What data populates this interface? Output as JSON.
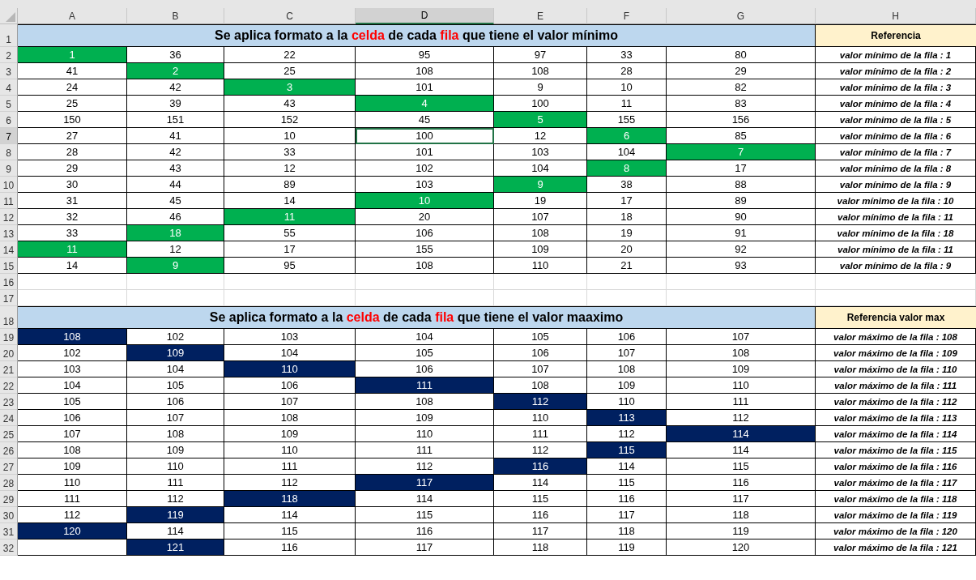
{
  "columns": [
    {
      "label": "A",
      "selected": false
    },
    {
      "label": "B",
      "selected": false
    },
    {
      "label": "C",
      "selected": false
    },
    {
      "label": "D",
      "selected": true
    },
    {
      "label": "E",
      "selected": false
    },
    {
      "label": "F",
      "selected": false
    },
    {
      "label": "G",
      "selected": false
    },
    {
      "label": "H",
      "selected": false
    }
  ],
  "rows": [
    {
      "number": "1",
      "selected": false,
      "kind": "title",
      "title": [
        {
          "text": "Se aplica formato a la ",
          "highlighted": false
        },
        {
          "text": "celda",
          "highlighted": true
        },
        {
          "text": " de cada ",
          "highlighted": false
        },
        {
          "text": "fila",
          "highlighted": true
        },
        {
          "text": " que tiene el valor mínimo",
          "highlighted": false
        }
      ],
      "reference": "Referencia"
    },
    {
      "number": "2",
      "selected": false,
      "kind": "data",
      "cells": [
        {
          "value": "1",
          "kind": "min"
        },
        {
          "value": "36",
          "kind": "plain"
        },
        {
          "value": "22",
          "kind": "plain"
        },
        {
          "value": "95",
          "kind": "plain"
        },
        {
          "value": "97",
          "kind": "plain"
        },
        {
          "value": "33",
          "kind": "plain"
        },
        {
          "value": "80",
          "kind": "plain"
        }
      ],
      "reference": "valor mínimo de la fila : 1"
    },
    {
      "number": "3",
      "selected": false,
      "kind": "data",
      "cells": [
        {
          "value": "41",
          "kind": "plain"
        },
        {
          "value": "2",
          "kind": "min"
        },
        {
          "value": "25",
          "kind": "plain"
        },
        {
          "value": "108",
          "kind": "plain"
        },
        {
          "value": "108",
          "kind": "plain"
        },
        {
          "value": "28",
          "kind": "plain"
        },
        {
          "value": "29",
          "kind": "plain"
        }
      ],
      "reference": "valor mínimo de la fila : 2"
    },
    {
      "number": "4",
      "selected": false,
      "kind": "data",
      "cells": [
        {
          "value": "24",
          "kind": "plain"
        },
        {
          "value": "42",
          "kind": "plain"
        },
        {
          "value": "3",
          "kind": "min"
        },
        {
          "value": "101",
          "kind": "plain"
        },
        {
          "value": "9",
          "kind": "plain"
        },
        {
          "value": "10",
          "kind": "plain"
        },
        {
          "value": "82",
          "kind": "plain"
        }
      ],
      "reference": "valor mínimo de la fila : 3"
    },
    {
      "number": "5",
      "selected": false,
      "kind": "data",
      "cells": [
        {
          "value": "25",
          "kind": "plain"
        },
        {
          "value": "39",
          "kind": "plain"
        },
        {
          "value": "43",
          "kind": "plain"
        },
        {
          "value": "4",
          "kind": "min"
        },
        {
          "value": "100",
          "kind": "plain"
        },
        {
          "value": "11",
          "kind": "plain"
        },
        {
          "value": "83",
          "kind": "plain"
        }
      ],
      "reference": "valor mínimo de la fila : 4"
    },
    {
      "number": "6",
      "selected": false,
      "kind": "data",
      "cells": [
        {
          "value": "150",
          "kind": "plain"
        },
        {
          "value": "151",
          "kind": "plain"
        },
        {
          "value": "152",
          "kind": "plain"
        },
        {
          "value": "45",
          "kind": "plain"
        },
        {
          "value": "5",
          "kind": "min"
        },
        {
          "value": "155",
          "kind": "plain"
        },
        {
          "value": "156",
          "kind": "plain"
        }
      ],
      "reference": "valor mínimo de la fila : 5"
    },
    {
      "number": "7",
      "selected": true,
      "kind": "data",
      "cells": [
        {
          "value": "27",
          "kind": "plain"
        },
        {
          "value": "41",
          "kind": "plain"
        },
        {
          "value": "10",
          "kind": "plain"
        },
        {
          "value": "100",
          "kind": "plain"
        },
        {
          "value": "12",
          "kind": "plain"
        },
        {
          "value": "6",
          "kind": "min"
        },
        {
          "value": "85",
          "kind": "plain"
        }
      ],
      "reference": "valor mínimo de la fila : 6"
    },
    {
      "number": "8",
      "selected": false,
      "kind": "data",
      "cells": [
        {
          "value": "28",
          "kind": "plain"
        },
        {
          "value": "42",
          "kind": "plain"
        },
        {
          "value": "33",
          "kind": "plain"
        },
        {
          "value": "101",
          "kind": "plain"
        },
        {
          "value": "103",
          "kind": "plain"
        },
        {
          "value": "104",
          "kind": "plain"
        },
        {
          "value": "7",
          "kind": "min"
        }
      ],
      "reference": "valor mínimo de la fila : 7"
    },
    {
      "number": "9",
      "selected": false,
      "kind": "data",
      "cells": [
        {
          "value": "29",
          "kind": "plain"
        },
        {
          "value": "43",
          "kind": "plain"
        },
        {
          "value": "12",
          "kind": "plain"
        },
        {
          "value": "102",
          "kind": "plain"
        },
        {
          "value": "104",
          "kind": "plain"
        },
        {
          "value": "8",
          "kind": "min"
        },
        {
          "value": "17",
          "kind": "plain"
        }
      ],
      "reference": "valor mínimo de la fila : 8"
    },
    {
      "number": "10",
      "selected": false,
      "kind": "data",
      "cells": [
        {
          "value": "30",
          "kind": "plain"
        },
        {
          "value": "44",
          "kind": "plain"
        },
        {
          "value": "89",
          "kind": "plain"
        },
        {
          "value": "103",
          "kind": "plain"
        },
        {
          "value": "9",
          "kind": "min"
        },
        {
          "value": "38",
          "kind": "plain"
        },
        {
          "value": "88",
          "kind": "plain"
        }
      ],
      "reference": "valor mínimo de la fila : 9"
    },
    {
      "number": "11",
      "selected": false,
      "kind": "data",
      "cells": [
        {
          "value": "31",
          "kind": "plain"
        },
        {
          "value": "45",
          "kind": "plain"
        },
        {
          "value": "14",
          "kind": "plain"
        },
        {
          "value": "10",
          "kind": "min"
        },
        {
          "value": "19",
          "kind": "plain"
        },
        {
          "value": "17",
          "kind": "plain"
        },
        {
          "value": "89",
          "kind": "plain"
        }
      ],
      "reference": "valor mínimo de la fila : 10"
    },
    {
      "number": "12",
      "selected": false,
      "kind": "data",
      "cells": [
        {
          "value": "32",
          "kind": "plain"
        },
        {
          "value": "46",
          "kind": "plain"
        },
        {
          "value": "11",
          "kind": "min"
        },
        {
          "value": "20",
          "kind": "plain"
        },
        {
          "value": "107",
          "kind": "plain"
        },
        {
          "value": "18",
          "kind": "plain"
        },
        {
          "value": "90",
          "kind": "plain"
        }
      ],
      "reference": "valor mínimo de la fila : 11"
    },
    {
      "number": "13",
      "selected": false,
      "kind": "data",
      "cells": [
        {
          "value": "33",
          "kind": "plain"
        },
        {
          "value": "18",
          "kind": "min"
        },
        {
          "value": "55",
          "kind": "plain"
        },
        {
          "value": "106",
          "kind": "plain"
        },
        {
          "value": "108",
          "kind": "plain"
        },
        {
          "value": "19",
          "kind": "plain"
        },
        {
          "value": "91",
          "kind": "plain"
        }
      ],
      "reference": "valor mínimo de la fila : 18"
    },
    {
      "number": "14",
      "selected": false,
      "kind": "data",
      "cells": [
        {
          "value": "11",
          "kind": "min"
        },
        {
          "value": "12",
          "kind": "plain"
        },
        {
          "value": "17",
          "kind": "plain"
        },
        {
          "value": "155",
          "kind": "plain"
        },
        {
          "value": "109",
          "kind": "plain"
        },
        {
          "value": "20",
          "kind": "plain"
        },
        {
          "value": "92",
          "kind": "plain"
        }
      ],
      "reference": "valor mínimo de la fila : 11"
    },
    {
      "number": "15",
      "selected": false,
      "kind": "data",
      "cells": [
        {
          "value": "14",
          "kind": "plain"
        },
        {
          "value": "9",
          "kind": "min"
        },
        {
          "value": "95",
          "kind": "plain"
        },
        {
          "value": "108",
          "kind": "plain"
        },
        {
          "value": "110",
          "kind": "plain"
        },
        {
          "value": "21",
          "kind": "plain"
        },
        {
          "value": "93",
          "kind": "plain"
        }
      ],
      "reference": "valor mínimo de la fila : 9"
    },
    {
      "number": "16",
      "selected": false,
      "kind": "blank"
    },
    {
      "number": "17",
      "selected": false,
      "kind": "blank"
    },
    {
      "number": "18",
      "selected": false,
      "kind": "title",
      "title": [
        {
          "text": "Se aplica formato a la ",
          "highlighted": false
        },
        {
          "text": "celda",
          "highlighted": true
        },
        {
          "text": " de cada ",
          "highlighted": false
        },
        {
          "text": "fila",
          "highlighted": true
        },
        {
          "text": " que tiene el valor maaximo",
          "highlighted": false
        }
      ],
      "reference": "Referencia valor max"
    },
    {
      "number": "19",
      "selected": false,
      "kind": "data",
      "cells": [
        {
          "value": "108",
          "kind": "max"
        },
        {
          "value": "102",
          "kind": "plain"
        },
        {
          "value": "103",
          "kind": "plain"
        },
        {
          "value": "104",
          "kind": "plain"
        },
        {
          "value": "105",
          "kind": "plain"
        },
        {
          "value": "106",
          "kind": "plain"
        },
        {
          "value": "107",
          "kind": "plain"
        }
      ],
      "reference": "valor máximo de la fila : 108"
    },
    {
      "number": "20",
      "selected": false,
      "kind": "data",
      "cells": [
        {
          "value": "102",
          "kind": "plain"
        },
        {
          "value": "109",
          "kind": "max"
        },
        {
          "value": "104",
          "kind": "plain"
        },
        {
          "value": "105",
          "kind": "plain"
        },
        {
          "value": "106",
          "kind": "plain"
        },
        {
          "value": "107",
          "kind": "plain"
        },
        {
          "value": "108",
          "kind": "plain"
        }
      ],
      "reference": "valor máximo de la fila : 109"
    },
    {
      "number": "21",
      "selected": false,
      "kind": "data",
      "cells": [
        {
          "value": "103",
          "kind": "plain"
        },
        {
          "value": "104",
          "kind": "plain"
        },
        {
          "value": "110",
          "kind": "max"
        },
        {
          "value": "106",
          "kind": "plain"
        },
        {
          "value": "107",
          "kind": "plain"
        },
        {
          "value": "108",
          "kind": "plain"
        },
        {
          "value": "109",
          "kind": "plain"
        }
      ],
      "reference": "valor máximo de la fila : 110"
    },
    {
      "number": "22",
      "selected": false,
      "kind": "data",
      "cells": [
        {
          "value": "104",
          "kind": "plain"
        },
        {
          "value": "105",
          "kind": "plain"
        },
        {
          "value": "106",
          "kind": "plain"
        },
        {
          "value": "111",
          "kind": "max"
        },
        {
          "value": "108",
          "kind": "plain"
        },
        {
          "value": "109",
          "kind": "plain"
        },
        {
          "value": "110",
          "kind": "plain"
        }
      ],
      "reference": "valor máximo de la fila : 111"
    },
    {
      "number": "23",
      "selected": false,
      "kind": "data",
      "cells": [
        {
          "value": "105",
          "kind": "plain"
        },
        {
          "value": "106",
          "kind": "plain"
        },
        {
          "value": "107",
          "kind": "plain"
        },
        {
          "value": "108",
          "kind": "plain"
        },
        {
          "value": "112",
          "kind": "max"
        },
        {
          "value": "110",
          "kind": "plain"
        },
        {
          "value": "111",
          "kind": "plain"
        }
      ],
      "reference": "valor máximo de la fila : 112"
    },
    {
      "number": "24",
      "selected": false,
      "kind": "data",
      "cells": [
        {
          "value": "106",
          "kind": "plain"
        },
        {
          "value": "107",
          "kind": "plain"
        },
        {
          "value": "108",
          "kind": "plain"
        },
        {
          "value": "109",
          "kind": "plain"
        },
        {
          "value": "110",
          "kind": "plain"
        },
        {
          "value": "113",
          "kind": "max"
        },
        {
          "value": "112",
          "kind": "plain"
        }
      ],
      "reference": "valor máximo de la fila : 113"
    },
    {
      "number": "25",
      "selected": false,
      "kind": "data",
      "cells": [
        {
          "value": "107",
          "kind": "plain"
        },
        {
          "value": "108",
          "kind": "plain"
        },
        {
          "value": "109",
          "kind": "plain"
        },
        {
          "value": "110",
          "kind": "plain"
        },
        {
          "value": "111",
          "kind": "plain"
        },
        {
          "value": "112",
          "kind": "plain"
        },
        {
          "value": "114",
          "kind": "max"
        }
      ],
      "reference": "valor máximo de la fila : 114"
    },
    {
      "number": "26",
      "selected": false,
      "kind": "data",
      "cells": [
        {
          "value": "108",
          "kind": "plain"
        },
        {
          "value": "109",
          "kind": "plain"
        },
        {
          "value": "110",
          "kind": "plain"
        },
        {
          "value": "111",
          "kind": "plain"
        },
        {
          "value": "112",
          "kind": "plain"
        },
        {
          "value": "115",
          "kind": "max"
        },
        {
          "value": "114",
          "kind": "plain"
        }
      ],
      "reference": "valor máximo de la fila : 115"
    },
    {
      "number": "27",
      "selected": false,
      "kind": "data",
      "cells": [
        {
          "value": "109",
          "kind": "plain"
        },
        {
          "value": "110",
          "kind": "plain"
        },
        {
          "value": "111",
          "kind": "plain"
        },
        {
          "value": "112",
          "kind": "plain"
        },
        {
          "value": "116",
          "kind": "max"
        },
        {
          "value": "114",
          "kind": "plain"
        },
        {
          "value": "115",
          "kind": "plain"
        }
      ],
      "reference": "valor máximo de la fila : 116"
    },
    {
      "number": "28",
      "selected": false,
      "kind": "data",
      "cells": [
        {
          "value": "110",
          "kind": "plain"
        },
        {
          "value": "111",
          "kind": "plain"
        },
        {
          "value": "112",
          "kind": "plain"
        },
        {
          "value": "117",
          "kind": "max"
        },
        {
          "value": "114",
          "kind": "plain"
        },
        {
          "value": "115",
          "kind": "plain"
        },
        {
          "value": "116",
          "kind": "plain"
        }
      ],
      "reference": "valor máximo de la fila : 117"
    },
    {
      "number": "29",
      "selected": false,
      "kind": "data",
      "cells": [
        {
          "value": "111",
          "kind": "plain"
        },
        {
          "value": "112",
          "kind": "plain"
        },
        {
          "value": "118",
          "kind": "max"
        },
        {
          "value": "114",
          "kind": "plain"
        },
        {
          "value": "115",
          "kind": "plain"
        },
        {
          "value": "116",
          "kind": "plain"
        },
        {
          "value": "117",
          "kind": "plain"
        }
      ],
      "reference": "valor máximo de la fila : 118"
    },
    {
      "number": "30",
      "selected": false,
      "kind": "data",
      "cells": [
        {
          "value": "112",
          "kind": "plain"
        },
        {
          "value": "119",
          "kind": "max"
        },
        {
          "value": "114",
          "kind": "plain"
        },
        {
          "value": "115",
          "kind": "plain"
        },
        {
          "value": "116",
          "kind": "plain"
        },
        {
          "value": "117",
          "kind": "plain"
        },
        {
          "value": "118",
          "kind": "plain"
        }
      ],
      "reference": "valor máximo de la fila : 119"
    },
    {
      "number": "31",
      "selected": false,
      "kind": "data",
      "cells": [
        {
          "value": "120",
          "kind": "max"
        },
        {
          "value": "114",
          "kind": "plain"
        },
        {
          "value": "115",
          "kind": "plain"
        },
        {
          "value": "116",
          "kind": "plain"
        },
        {
          "value": "117",
          "kind": "plain"
        },
        {
          "value": "118",
          "kind": "plain"
        },
        {
          "value": "119",
          "kind": "plain"
        }
      ],
      "reference": "valor máximo de la fila : 120"
    },
    {
      "number": "32",
      "selected": false,
      "kind": "data",
      "cells": [
        {
          "kind": "blank"
        },
        {
          "value": "121",
          "kind": "max"
        },
        {
          "value": "116",
          "kind": "plain"
        },
        {
          "value": "117",
          "kind": "plain"
        },
        {
          "value": "118",
          "kind": "plain"
        },
        {
          "value": "119",
          "kind": "plain"
        },
        {
          "value": "120",
          "kind": "plain"
        }
      ],
      "reference": "valor máximo de la fila : 121"
    }
  ]
}
